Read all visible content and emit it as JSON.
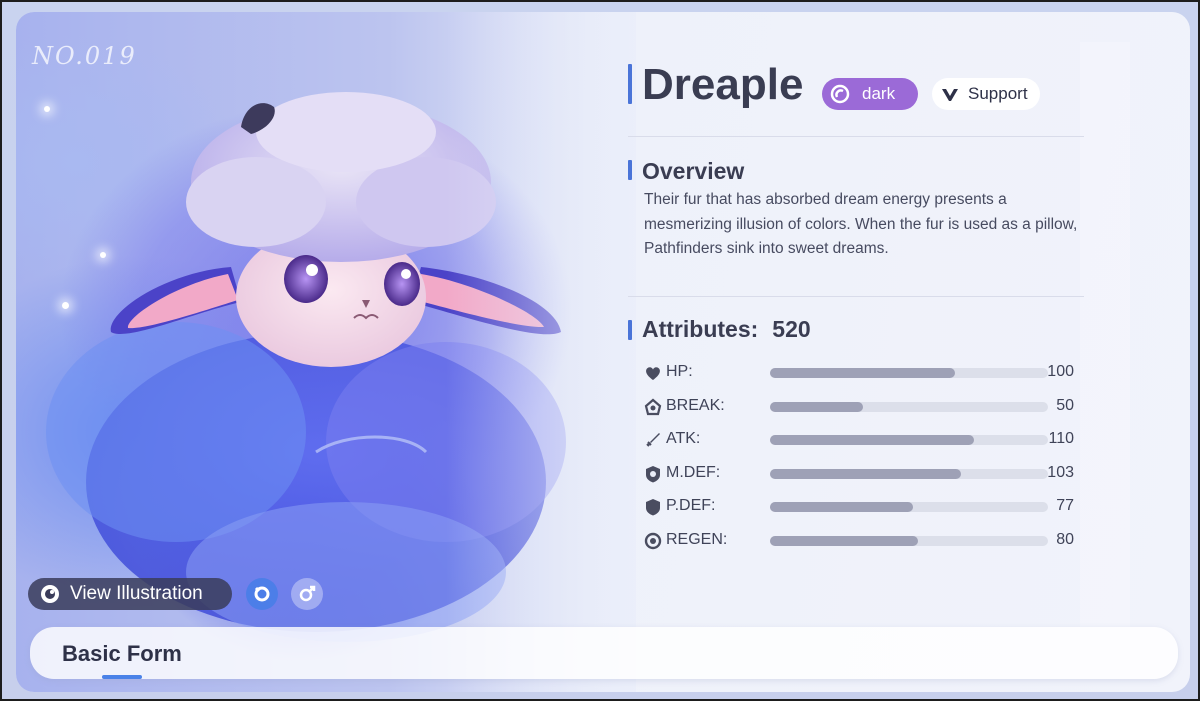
{
  "art": {
    "number_label": "NO.019"
  },
  "actions": {
    "view_illustration": "View Illustration"
  },
  "form": {
    "active_tab": "Basic Form"
  },
  "creature": {
    "name": "Dreaple",
    "type_tag": "dark",
    "role_tag": "Support"
  },
  "overview": {
    "title": "Overview",
    "text": "Their fur that has absorbed dream energy presents a mesmerizing illusion of colors. When the fur is used as a pillow, Pathfinders sink into sweet dreams."
  },
  "attributes": {
    "title": "Attributes:",
    "total": "520",
    "max_value": 150,
    "stats": [
      {
        "label": "HP:",
        "value": 100,
        "icon": "heart-icon"
      },
      {
        "label": "BREAK:",
        "value": 50,
        "icon": "break-icon"
      },
      {
        "label": "ATK:",
        "value": 110,
        "icon": "sword-icon"
      },
      {
        "label": "M.DEF:",
        "value": 103,
        "icon": "magic-shield-icon"
      },
      {
        "label": "P.DEF:",
        "value": 77,
        "icon": "shield-icon"
      },
      {
        "label": "REGEN:",
        "value": 80,
        "icon": "regen-icon"
      }
    ]
  },
  "colors": {
    "accent_blue": "#4a74d8",
    "type_purple": "#9b6ad7",
    "bar_fill": "#9ea1b6",
    "bar_track": "#dcdfea"
  }
}
